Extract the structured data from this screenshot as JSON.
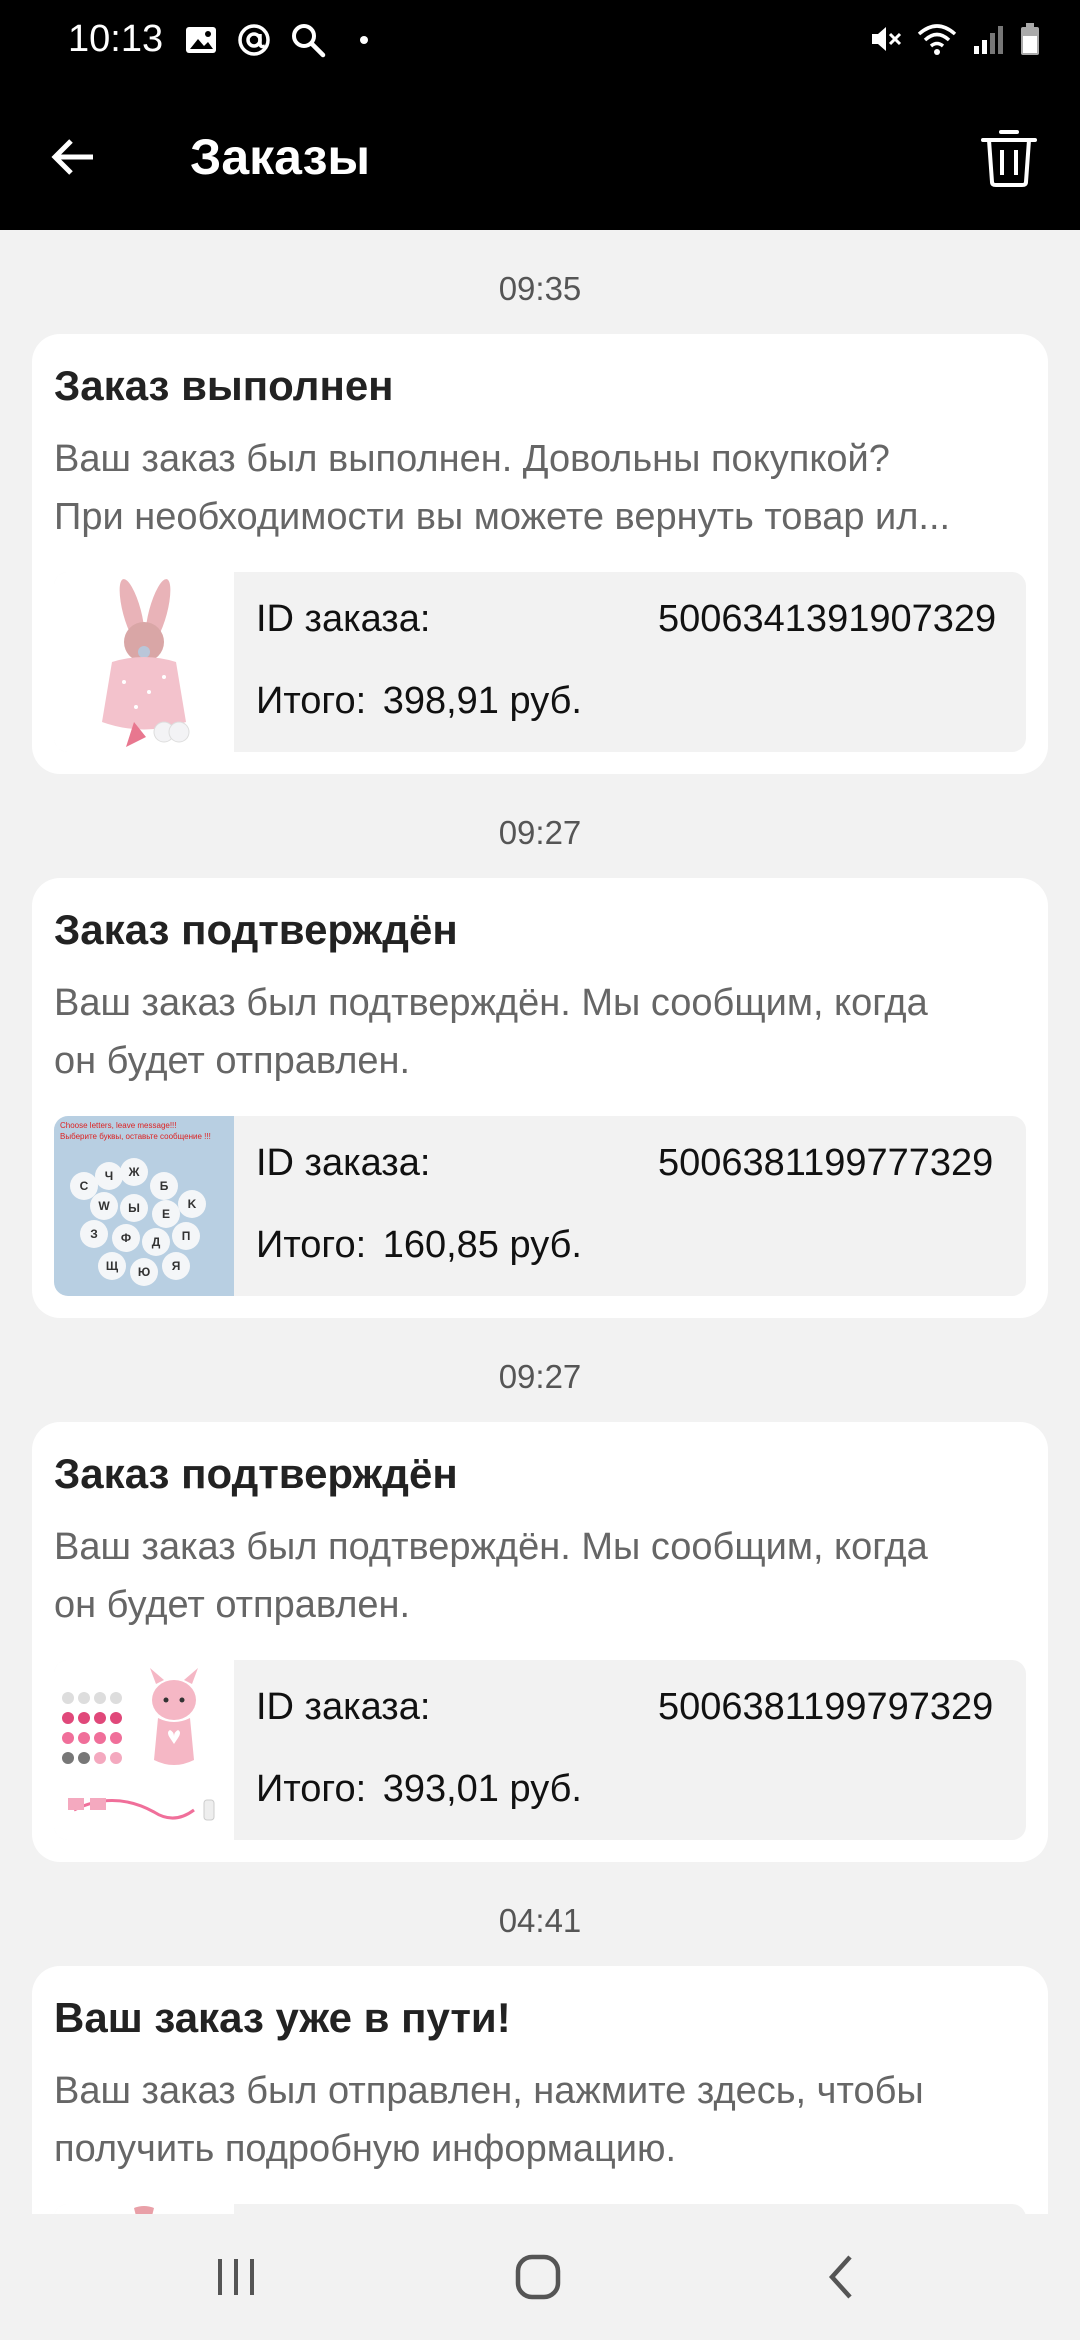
{
  "status_bar": {
    "time": "10:13"
  },
  "header": {
    "title": "Заказы"
  },
  "orders": [
    {
      "timestamp": "09:35",
      "title": "Заказ выполнен",
      "body_lines": [
        "Ваш заказ был выполнен. Довольны покупкой?",
        "При необходимости вы можете вернуть товар ил..."
      ],
      "id_label": "ID заказа:",
      "id_value": "5006341391907329",
      "total_label": "Итого:",
      "total_value": "398,91 руб.",
      "thumb": "pink-bunny-toy"
    },
    {
      "timestamp": "09:27",
      "title": "Заказ подтверждён",
      "body_lines": [
        "Ваш заказ был подтверждён. Мы сообщим, когда",
        "он будет отправлен."
      ],
      "id_label": "ID заказа:",
      "id_value": "5006381199777329",
      "total_label": "Итого:",
      "total_value": "160,85 руб.",
      "thumb": "letter-beads",
      "thumb_caption_1": "Choose letters, leave message!!!",
      "thumb_caption_2": "Выберите буквы, оставьте сообщение !!!"
    },
    {
      "timestamp": "09:27",
      "title": "Заказ подтверждён",
      "body_lines": [
        "Ваш заказ был подтверждён. Мы сообщим, когда",
        "он будет отправлен."
      ],
      "id_label": "ID заказа:",
      "id_value": "5006381199797329",
      "total_label": "Итого:",
      "total_value": "393,01 руб.",
      "thumb": "deer-teether-set"
    },
    {
      "timestamp": "04:41",
      "title": "Ваш заказ уже в пути!",
      "body_lines": [
        "Ваш заказ был отправлен, нажмите здесь, чтобы",
        "получить подробную информацию."
      ],
      "thumb": "pink-toy-partial"
    }
  ],
  "colors": {
    "bar_bg": "#000000",
    "page_bg": "#f2f2f2",
    "card_bg": "#ffffff",
    "accent_pink": "#e87a9a"
  }
}
